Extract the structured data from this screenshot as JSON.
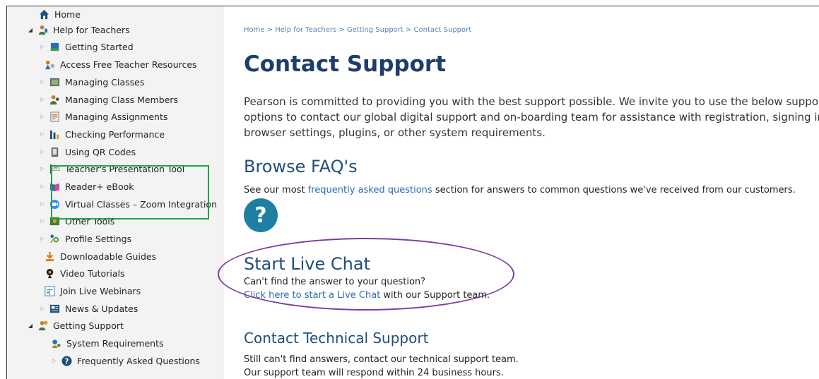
{
  "sidebar": {
    "items": [
      {
        "label": "Home",
        "icon": "home-icon",
        "arrow": ""
      },
      {
        "label": "Help for Teachers",
        "icon": "teacher-icon",
        "arrow": "open"
      },
      {
        "label": "Getting Started",
        "icon": "book-icon",
        "arrow": "closed"
      },
      {
        "label": "Access Free Teacher Resources",
        "icon": "resources-icon",
        "arrow": ""
      },
      {
        "label": "Managing Classes",
        "icon": "classes-icon",
        "arrow": "closed"
      },
      {
        "label": "Managing Class Members",
        "icon": "members-icon",
        "arrow": "closed"
      },
      {
        "label": "Managing Assignments",
        "icon": "assignments-icon",
        "arrow": "closed"
      },
      {
        "label": "Checking Performance",
        "icon": "bar-chart-icon",
        "arrow": "closed"
      },
      {
        "label": "Using QR Codes",
        "icon": "qr-code-icon",
        "arrow": "closed"
      },
      {
        "label": "Teacher's Presentation Tool",
        "icon": "presentation-icon",
        "arrow": "closed"
      },
      {
        "label": "Reader+ eBook",
        "icon": "ebook-icon",
        "arrow": "closed"
      },
      {
        "label": "Virtual Classes – Zoom Integration",
        "icon": "zoom-icon",
        "arrow": "closed"
      },
      {
        "label": "Other Tools",
        "icon": "tools-icon",
        "arrow": "closed"
      },
      {
        "label": "Profile Settings",
        "icon": "profile-settings-icon",
        "arrow": "closed"
      },
      {
        "label": "Downloadable Guides",
        "icon": "download-icon",
        "arrow": ""
      },
      {
        "label": "Video Tutorials",
        "icon": "video-icon",
        "arrow": ""
      },
      {
        "label": "Join Live Webinars",
        "icon": "webinar-icon",
        "arrow": ""
      },
      {
        "label": "News & Updates",
        "icon": "news-icon",
        "arrow": "closed"
      },
      {
        "label": "Getting Support",
        "icon": "support-icon",
        "arrow": "open"
      },
      {
        "label": "System Requirements",
        "icon": "system-requirements-icon",
        "arrow": ""
      },
      {
        "label": "Frequently Asked Questions",
        "icon": "faq-icon",
        "arrow": "closed"
      }
    ]
  },
  "main": {
    "breadcrumb": "Home > Help for Teachers > Getting Support > Contact Support",
    "title": "Contact Support",
    "intro": "Pearson is committed to providing you with the best support possible. We invite you to use the below support options to contact our global digital support and on-boarding team for assistance with registration, signing in, browser settings, plugins, or other system requirements.",
    "faq": {
      "heading": "Browse FAQ's",
      "text_before": "See our most ",
      "link": "frequently asked questions",
      "text_after": " section for answers to common questions we've received from our customers.",
      "icon_glyph": "?"
    },
    "chat": {
      "heading": "Start Live Chat",
      "line1": "Can't find the answer to your question?",
      "link": "Click here to start a Live Chat",
      "after_link": " with our Support team."
    },
    "tech": {
      "heading": "Contact Technical Support",
      "line1": "Still can't find answers, contact our technical support team.",
      "line2": "Our support team will respond within 24 business hours."
    }
  },
  "colors": {
    "title": "#1f3d6b",
    "link": "#2b6cb0",
    "highlight_box": "#22a34a",
    "highlight_ellipse": "#7b3fa0",
    "faq_circle": "#1e7fa3"
  }
}
